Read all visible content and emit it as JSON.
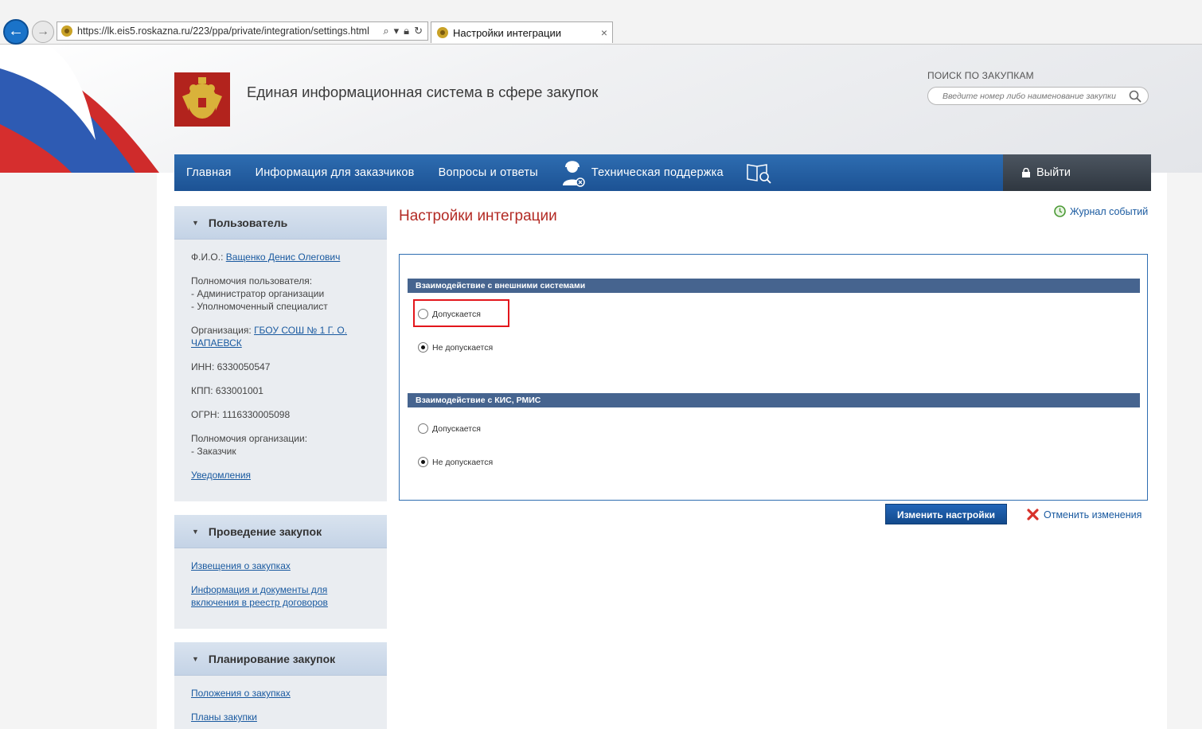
{
  "browser": {
    "url": "https://lk.eis5.roskazna.ru/223/ppa/private/integration/settings.html",
    "tab_title": "Настройки интеграции",
    "tab_close": "×",
    "back_icon": "←",
    "forward_icon": "→"
  },
  "header": {
    "site_title": "Единая информационная система в сфере закупок",
    "search_label": "ПОИСК ПО ЗАКУПКАМ",
    "search_placeholder": "Введите номер либо наименование закупки"
  },
  "nav": {
    "items": [
      "Главная",
      "Информация для заказчиков",
      "Вопросы и ответы"
    ],
    "support": "Техническая поддержка",
    "logout": "Выйти"
  },
  "sidebar": {
    "user": {
      "title": "Пользователь",
      "fio_label": "Ф.И.О.:",
      "fio_value": "Ващенко Денис Олегович",
      "rights_label": "Полномочия пользователя:",
      "rights": [
        "- Администратор организации",
        "- Уполномоченный специалист"
      ],
      "org_label": "Организация:",
      "org_value": "ГБОУ СОШ № 1 Г. О. ЧАПАЕВСК",
      "inn": "ИНН: 6330050547",
      "kpp": "КПП: 633001001",
      "ogrn": "ОГРН: 1116330005098",
      "org_rights_label": "Полномочия организации:",
      "org_rights": "- Заказчик",
      "notifications": "Уведомления"
    },
    "procurement": {
      "title": "Проведение закупок",
      "links": [
        "Извещения о закупках",
        "Информация и документы для включения в реестр договоров"
      ]
    },
    "planning": {
      "title": "Планирование закупок",
      "links": [
        "Положения о закупках",
        "Планы закупки"
      ]
    }
  },
  "main": {
    "title": "Настройки интеграции",
    "journal": "Журнал событий",
    "sections": [
      {
        "title": "Взаимодействие с внешними системами",
        "options": [
          "Допускается",
          "Не допускается"
        ],
        "selected": "Не допускается"
      },
      {
        "title": "Взаимодействие с КИС, РМИС",
        "options": [
          "Допускается",
          "Не допускается"
        ],
        "selected": "Не допускается"
      }
    ],
    "save_button": "Изменить настройки",
    "cancel_link": "Отменить изменения"
  },
  "colors": {
    "nav_blue": "#1c5294",
    "section_bar": "#46648f",
    "title_red": "#b32a24",
    "highlight_red": "#e3161c"
  }
}
